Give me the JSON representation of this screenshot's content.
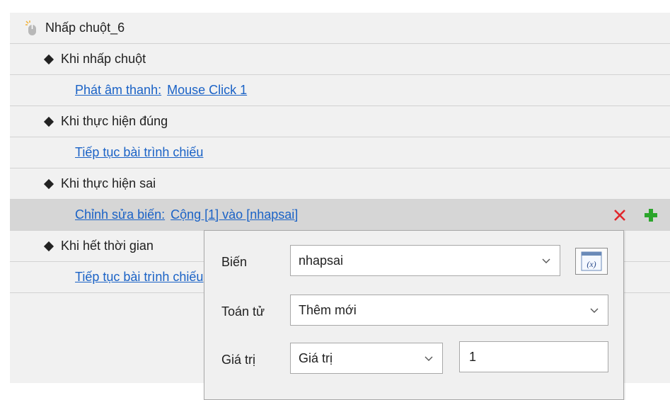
{
  "trigger": {
    "title": "Nhấp chuột_6",
    "icon": "mouse-click-icon"
  },
  "events": [
    {
      "label": "Khi nhấp chuột"
    },
    {
      "label": "Khi thực hiện đúng"
    },
    {
      "label": "Khi thực hiện sai"
    },
    {
      "label": "Khi hết thời gian"
    }
  ],
  "actions": [
    {
      "action": "Phát âm thanh:",
      "detail": "Mouse Click 1"
    },
    {
      "action": "Tiếp tục bài trình chiếu"
    },
    {
      "action": "Chỉnh sửa biến:",
      "detail": "Cộng [1] vào [nhapsai]"
    },
    {
      "action": "Tiếp tục bài trình chiếu"
    }
  ],
  "row_buttons": {
    "delete_icon": "close-x-icon",
    "add_icon": "plus-icon"
  },
  "colors": {
    "link": "#1a62c6",
    "delete": "#e0262b",
    "add": "#2ca52c",
    "selected_row": "#d6d6d6"
  },
  "popup": {
    "variable_label": "Biến",
    "variable_value": "nhapsai",
    "variable_button_icon": "variable-x-icon",
    "variable_button_text": "(x)",
    "operator_label": "Toán tử",
    "operator_value": "Thêm mới",
    "value_label": "Giá trị",
    "value_type": "Giá trị",
    "value_input": "1"
  }
}
